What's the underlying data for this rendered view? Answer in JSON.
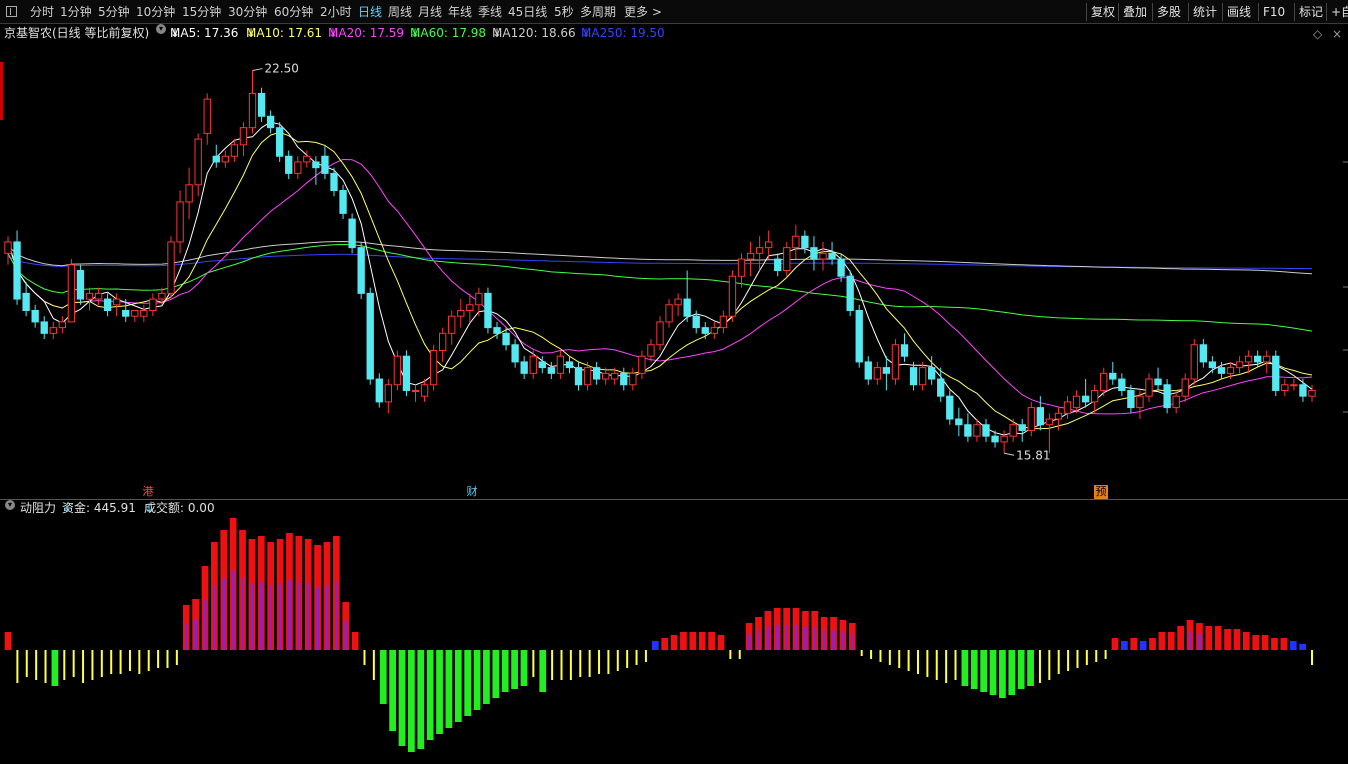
{
  "toolbar": {
    "periods": [
      "分时",
      "1分钟",
      "5分钟",
      "10分钟",
      "15分钟",
      "30分钟",
      "60分钟",
      "2小时",
      "日线",
      "周线",
      "月线",
      "年线",
      "季线",
      "45日线",
      "5秒",
      "多周期",
      "更多 >"
    ],
    "active_period": "日线",
    "right_buttons": [
      "复权",
      "叠加",
      "多股",
      "统计",
      "画线",
      "F10",
      "标记",
      "+自"
    ]
  },
  "legend": {
    "title": "京基智农(日线 等比前复权)",
    "ma5": "MA5: 17.36",
    "ma10": "MA10: 17.61",
    "ma20": "MA20: 17.59",
    "ma60": "MA60: 17.98",
    "ma120": "MA120: 18.66",
    "ma250": "MA250: 19.50",
    "arrow": "↓"
  },
  "colors": {
    "up": "#ff3333",
    "down": "#55e8f0",
    "ma5": "#ffffff",
    "ma10": "#ffff66",
    "ma20": "#ff44ff",
    "ma60": "#44ff44",
    "ma120": "#cccccc",
    "ma250": "#3344ff",
    "hist_red": "#ee1111",
    "hist_purple": "#8822cc",
    "hist_yellow": "#ffff44",
    "hist_green": "#22ee22",
    "hist_blue": "#2233ff"
  },
  "annotations": {
    "high_label": "22.50",
    "low_label": "15.81",
    "tag_gang": "港",
    "tag_cai": "财",
    "tag_yu": "预"
  },
  "sub_legend": {
    "name": "动阻力",
    "fund": "资金: 445.91",
    "volume": "成交额: 0.00",
    "arrow": "↓"
  },
  "chart_data": {
    "type": "candlestick",
    "ylim": [
      15.0,
      23.0
    ],
    "candles": [
      [
        19.3,
        19.6,
        19.1,
        19.5
      ],
      [
        19.5,
        19.7,
        18.4,
        18.5
      ],
      [
        18.6,
        18.8,
        18.2,
        18.3
      ],
      [
        18.3,
        18.4,
        18.0,
        18.1
      ],
      [
        18.1,
        18.2,
        17.8,
        17.9
      ],
      [
        17.9,
        18.1,
        17.8,
        18.0
      ],
      [
        18.0,
        18.2,
        17.9,
        18.1
      ],
      [
        18.1,
        19.2,
        18.1,
        19.1
      ],
      [
        19.0,
        19.1,
        18.4,
        18.5
      ],
      [
        18.5,
        18.7,
        18.3,
        18.6
      ],
      [
        18.5,
        18.7,
        18.4,
        18.6
      ],
      [
        18.5,
        18.6,
        18.2,
        18.3
      ],
      [
        18.4,
        18.6,
        18.2,
        18.5
      ],
      [
        18.3,
        18.5,
        18.1,
        18.2
      ],
      [
        18.2,
        18.3,
        18.1,
        18.3
      ],
      [
        18.2,
        18.4,
        18.1,
        18.3
      ],
      [
        18.3,
        18.6,
        18.2,
        18.5
      ],
      [
        18.5,
        18.7,
        18.4,
        18.6
      ],
      [
        18.6,
        19.6,
        18.5,
        19.5
      ],
      [
        19.5,
        20.4,
        19.3,
        20.2
      ],
      [
        20.2,
        20.8,
        19.9,
        20.5
      ],
      [
        20.5,
        21.4,
        20.3,
        21.3
      ],
      [
        21.4,
        22.1,
        21.2,
        22.0
      ],
      [
        21.0,
        21.2,
        20.8,
        20.9
      ],
      [
        20.9,
        21.1,
        20.8,
        21.0
      ],
      [
        21.0,
        21.3,
        20.9,
        21.2
      ],
      [
        21.2,
        21.6,
        21.0,
        21.5
      ],
      [
        21.5,
        22.5,
        21.4,
        22.1
      ],
      [
        22.1,
        22.2,
        21.6,
        21.7
      ],
      [
        21.7,
        21.8,
        21.4,
        21.5
      ],
      [
        21.5,
        21.6,
        20.9,
        21.0
      ],
      [
        21.0,
        21.1,
        20.6,
        20.7
      ],
      [
        20.7,
        21.0,
        20.6,
        20.9
      ],
      [
        20.9,
        21.1,
        20.8,
        21.0
      ],
      [
        20.9,
        21.0,
        20.5,
        20.8
      ],
      [
        21.0,
        21.2,
        20.6,
        20.7
      ],
      [
        20.7,
        20.8,
        20.3,
        20.4
      ],
      [
        20.4,
        20.5,
        19.9,
        20.0
      ],
      [
        19.9,
        20.0,
        19.3,
        19.4
      ],
      [
        19.4,
        19.5,
        18.5,
        18.6
      ],
      [
        18.6,
        18.7,
        17.0,
        17.1
      ],
      [
        17.1,
        17.2,
        16.6,
        16.7
      ],
      [
        16.7,
        17.1,
        16.5,
        17.0
      ],
      [
        17.0,
        17.6,
        16.9,
        17.5
      ],
      [
        17.5,
        17.6,
        16.8,
        16.9
      ],
      [
        16.9,
        17.0,
        16.7,
        16.9
      ],
      [
        16.8,
        17.1,
        16.7,
        17.0
      ],
      [
        17.0,
        17.7,
        16.9,
        17.6
      ],
      [
        17.6,
        18.0,
        17.4,
        17.9
      ],
      [
        17.9,
        18.3,
        17.7,
        18.2
      ],
      [
        18.2,
        18.5,
        18.0,
        18.3
      ],
      [
        18.3,
        18.6,
        18.1,
        18.4
      ],
      [
        18.4,
        18.7,
        18.2,
        18.6
      ],
      [
        18.6,
        18.7,
        17.9,
        18.0
      ],
      [
        18.0,
        18.1,
        17.8,
        17.9
      ],
      [
        17.9,
        18.0,
        17.6,
        17.7
      ],
      [
        17.7,
        17.8,
        17.3,
        17.4
      ],
      [
        17.4,
        17.5,
        17.1,
        17.2
      ],
      [
        17.2,
        17.6,
        17.1,
        17.5
      ],
      [
        17.4,
        17.5,
        17.2,
        17.3
      ],
      [
        17.3,
        17.4,
        17.1,
        17.2
      ],
      [
        17.2,
        17.6,
        17.1,
        17.5
      ],
      [
        17.4,
        17.5,
        17.2,
        17.3
      ],
      [
        17.3,
        17.4,
        16.9,
        17.0
      ],
      [
        17.0,
        17.4,
        16.9,
        17.3
      ],
      [
        17.3,
        17.4,
        17.0,
        17.1
      ],
      [
        17.1,
        17.3,
        17.0,
        17.2
      ],
      [
        17.1,
        17.3,
        17.0,
        17.2
      ],
      [
        17.2,
        17.3,
        16.9,
        17.0
      ],
      [
        17.0,
        17.3,
        16.9,
        17.2
      ],
      [
        17.2,
        17.6,
        17.1,
        17.5
      ],
      [
        17.5,
        17.8,
        17.4,
        17.7
      ],
      [
        17.7,
        18.2,
        17.6,
        18.1
      ],
      [
        18.1,
        18.5,
        18.0,
        18.4
      ],
      [
        18.4,
        18.6,
        18.2,
        18.5
      ],
      [
        18.5,
        19.0,
        18.1,
        18.2
      ],
      [
        18.2,
        18.3,
        17.9,
        18.0
      ],
      [
        18.0,
        18.1,
        17.8,
        17.9
      ],
      [
        17.9,
        18.1,
        17.8,
        18.0
      ],
      [
        18.0,
        18.3,
        17.9,
        18.2
      ],
      [
        18.2,
        19.0,
        18.1,
        18.9
      ],
      [
        18.9,
        19.3,
        18.7,
        19.2
      ],
      [
        19.2,
        19.5,
        18.9,
        19.3
      ],
      [
        19.3,
        19.6,
        19.0,
        19.4
      ],
      [
        19.4,
        19.7,
        19.2,
        19.5
      ],
      [
        19.2,
        19.3,
        18.9,
        19.0
      ],
      [
        19.0,
        19.5,
        18.9,
        19.4
      ],
      [
        19.4,
        19.8,
        19.2,
        19.6
      ],
      [
        19.6,
        19.7,
        19.3,
        19.4
      ],
      [
        19.4,
        19.6,
        19.0,
        19.2
      ],
      [
        19.2,
        19.5,
        19.0,
        19.3
      ],
      [
        19.3,
        19.5,
        19.1,
        19.2
      ],
      [
        19.2,
        19.3,
        18.8,
        18.9
      ],
      [
        18.9,
        19.0,
        18.2,
        18.3
      ],
      [
        18.3,
        18.4,
        17.3,
        17.4
      ],
      [
        17.4,
        17.5,
        17.0,
        17.1
      ],
      [
        17.1,
        17.4,
        17.0,
        17.3
      ],
      [
        17.3,
        17.5,
        16.9,
        17.2
      ],
      [
        17.1,
        17.8,
        17.0,
        17.7
      ],
      [
        17.7,
        17.9,
        17.4,
        17.5
      ],
      [
        17.3,
        17.4,
        16.9,
        17.0
      ],
      [
        17.0,
        17.4,
        16.9,
        17.3
      ],
      [
        17.3,
        17.5,
        17.0,
        17.1
      ],
      [
        17.1,
        17.3,
        16.7,
        16.8
      ],
      [
        16.8,
        16.9,
        16.3,
        16.4
      ],
      [
        16.4,
        16.6,
        16.1,
        16.3
      ],
      [
        16.3,
        16.5,
        16.0,
        16.1
      ],
      [
        16.1,
        16.4,
        16.0,
        16.3
      ],
      [
        16.3,
        16.4,
        16.0,
        16.1
      ],
      [
        16.1,
        16.2,
        15.9,
        16.0
      ],
      [
        16.0,
        16.2,
        15.8,
        16.1
      ],
      [
        16.1,
        16.4,
        16.0,
        16.3
      ],
      [
        16.3,
        16.4,
        16.0,
        16.2
      ],
      [
        16.2,
        16.7,
        16.1,
        16.6
      ],
      [
        16.6,
        16.8,
        16.2,
        16.3
      ],
      [
        16.3,
        16.5,
        15.8,
        16.4
      ],
      [
        16.4,
        16.6,
        16.2,
        16.5
      ],
      [
        16.5,
        16.8,
        16.4,
        16.7
      ],
      [
        16.6,
        16.9,
        16.5,
        16.8
      ],
      [
        16.8,
        17.1,
        16.6,
        16.7
      ],
      [
        16.7,
        17.0,
        16.5,
        16.9
      ],
      [
        16.9,
        17.3,
        16.8,
        17.2
      ],
      [
        17.2,
        17.4,
        17.0,
        17.1
      ],
      [
        17.1,
        17.2,
        16.8,
        16.9
      ],
      [
        16.9,
        17.0,
        16.5,
        16.6
      ],
      [
        16.6,
        16.9,
        16.4,
        16.8
      ],
      [
        16.8,
        17.2,
        16.7,
        17.1
      ],
      [
        17.1,
        17.3,
        16.9,
        17.0
      ],
      [
        17.0,
        17.1,
        16.5,
        16.6
      ],
      [
        16.6,
        16.9,
        16.5,
        16.8
      ],
      [
        16.8,
        17.2,
        16.7,
        17.1
      ],
      [
        17.1,
        17.8,
        17.0,
        17.7
      ],
      [
        17.7,
        17.8,
        17.3,
        17.4
      ],
      [
        17.4,
        17.5,
        17.2,
        17.3
      ],
      [
        17.3,
        17.4,
        17.1,
        17.2
      ],
      [
        17.2,
        17.4,
        17.1,
        17.3
      ],
      [
        17.3,
        17.5,
        17.2,
        17.4
      ],
      [
        17.4,
        17.6,
        17.2,
        17.5
      ],
      [
        17.5,
        17.6,
        17.3,
        17.4
      ],
      [
        17.4,
        17.6,
        17.2,
        17.5
      ],
      [
        17.5,
        17.6,
        16.8,
        16.9
      ],
      [
        16.9,
        17.1,
        16.8,
        17.0
      ],
      [
        17.0,
        17.1,
        16.9,
        17.0
      ],
      [
        17.0,
        17.1,
        16.7,
        16.8
      ],
      [
        16.8,
        17.0,
        16.7,
        16.9
      ]
    ],
    "dynamic_resistance": [
      6,
      -11,
      -9,
      -10,
      -11,
      -12,
      -10,
      -9,
      -11,
      -10,
      -9,
      -8,
      -8,
      -7,
      -8,
      -7,
      -6,
      -6,
      -5,
      15,
      17,
      28,
      36,
      40,
      44,
      40,
      37,
      38,
      36,
      37,
      39,
      38,
      37,
      35,
      36,
      38,
      16,
      6,
      -5,
      -10,
      -18,
      -27,
      -32,
      -34,
      -33,
      -30,
      -28,
      -26,
      -24,
      -22,
      -20,
      -18,
      -16,
      -14,
      -13,
      -12,
      -9,
      -14,
      -10,
      -10,
      -10,
      -9,
      -9,
      -8,
      -8,
      -7,
      -6,
      -5,
      -4,
      3,
      4,
      5,
      6,
      6,
      6,
      6,
      5,
      -3,
      -3,
      9,
      11,
      13,
      14,
      14,
      14,
      13,
      13,
      11,
      11,
      10,
      9,
      -2,
      -3,
      -4,
      -5,
      -6,
      -7,
      -8,
      -9,
      -10,
      -11,
      -10,
      -12,
      -13,
      -14,
      -15,
      -16,
      -15,
      -13,
      -12,
      -11,
      -10,
      -8,
      -7,
      -6,
      -5,
      -4,
      -3,
      4,
      3,
      4,
      3,
      4,
      6,
      6,
      8,
      10,
      9,
      8,
      8,
      7,
      7,
      6,
      5,
      5,
      4,
      4,
      3,
      2,
      -5
    ]
  }
}
